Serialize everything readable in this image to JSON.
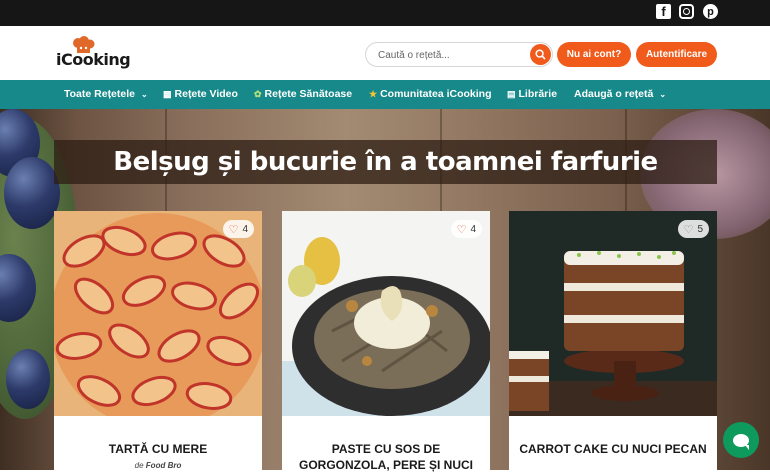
{
  "topbar": {
    "social": [
      "facebook-icon",
      "instagram-icon",
      "pinterest-icon"
    ]
  },
  "header": {
    "logo_text": "iCooking",
    "search_placeholder": "Caută o rețetă...",
    "btn_no_account": "Nu ai cont?",
    "btn_login": "Autentificare"
  },
  "nav": {
    "items": [
      {
        "label": "Toate Rețetele",
        "icon": "",
        "dropdown": true
      },
      {
        "label": "Rețete Video",
        "icon": "video-icon",
        "dropdown": false
      },
      {
        "label": "Rețete Sănătoase",
        "icon": "leaf-icon",
        "dropdown": false
      },
      {
        "label": "Comunitatea iCooking",
        "icon": "star-icon",
        "dropdown": false
      },
      {
        "label": "Librărie",
        "icon": "book-icon",
        "dropdown": false
      },
      {
        "label": "Adaugă o rețetă",
        "icon": "",
        "dropdown": true
      }
    ]
  },
  "hero": {
    "title": "Belșug și bucurie în a toamnei farfurie"
  },
  "cards": [
    {
      "title": "TARTĂ CU MERE",
      "likes": "4",
      "author_prefix": "de",
      "author": "Food Bro"
    },
    {
      "title": "PASTE CU SOS DE GORGONZOLA, PERE ȘI NUCI",
      "likes": "4"
    },
    {
      "title": "CARROT CAKE CU NUCI PECAN",
      "likes": "5"
    }
  ],
  "colors": {
    "accent": "#f05a1a",
    "nav": "#17898a",
    "topbar": "#161616",
    "chat": "#0e9a5c"
  }
}
